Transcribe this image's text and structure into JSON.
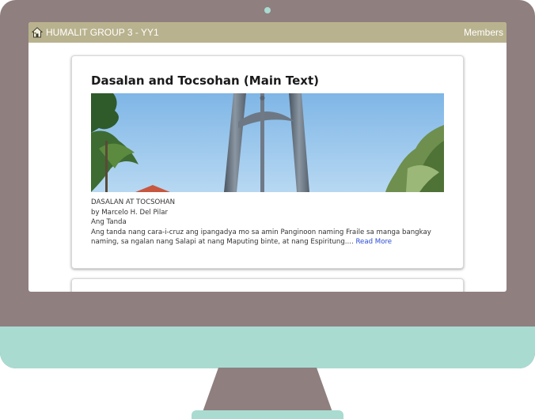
{
  "navbar": {
    "brand": "HUMALIT GROUP 3 - YY1",
    "members_link": "Members"
  },
  "post": {
    "title": "Dasalan and Tocsohan (Main Text)",
    "line1": "DASALAN AT TOCSOHAN",
    "line2": "by Marcelo H. Del Pilar",
    "line3": "Ang Tanda",
    "excerpt": "Ang tanda nang cara-i-cruz ang ipangadya mo sa amin Panginoon naming Fraile sa manga bangkay naming, sa ngalan nang Salapi at nang Maputing binte, at nang Espiritung....",
    "read_more": "Read More"
  },
  "colors": {
    "monitor_body": "#8f7f7f",
    "monitor_accent": "#a9dbd1",
    "navbar": "#b9b28e",
    "link": "#2a4bd7"
  },
  "icons": {
    "brand": "home-icon"
  }
}
